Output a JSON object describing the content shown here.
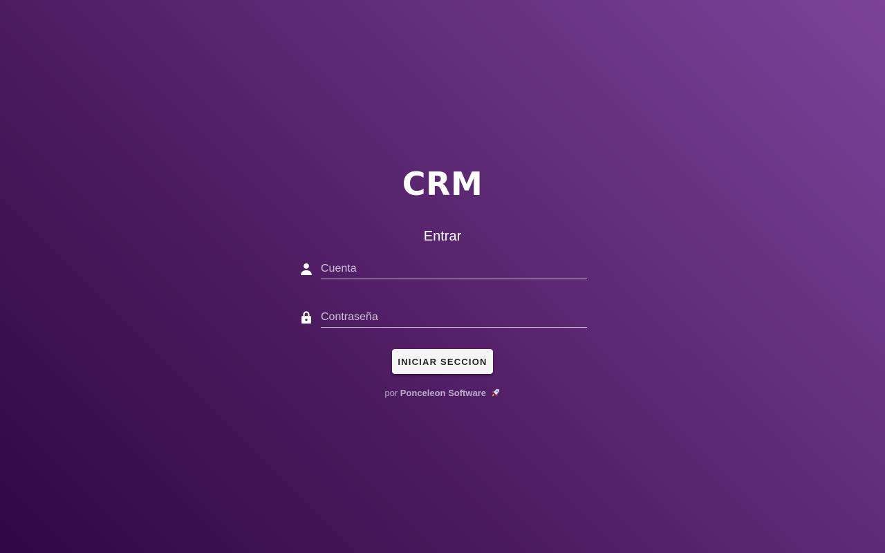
{
  "app": {
    "title": "CRM"
  },
  "login": {
    "heading": "Entrar",
    "account": {
      "placeholder": "Cuenta",
      "value": "",
      "icon": "person-icon"
    },
    "password": {
      "placeholder": "Contraseña",
      "value": "",
      "icon": "lock-icon"
    },
    "submit_label": "INICIAR SECCION"
  },
  "footer": {
    "prefix": "por",
    "company": "Ponceleon Software",
    "icon": "rocket-icon"
  },
  "colors": {
    "background_start": "#2f0845",
    "background_end": "#7c4398",
    "button_background": "#f5f5f5",
    "text": "#ffffff"
  }
}
